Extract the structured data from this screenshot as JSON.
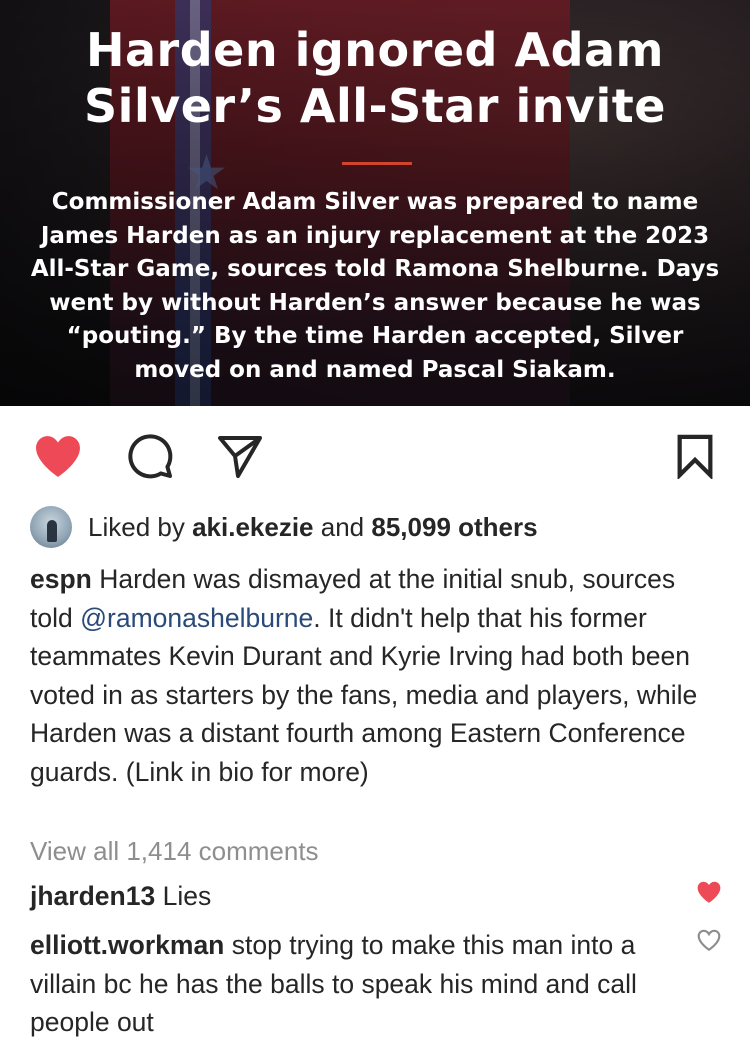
{
  "post_image": {
    "headline": "Harden ignored Adam Silver’s All-Star invite",
    "dek": "Commissioner Adam Silver was prepared to name James Harden as an injury replacement at the 2023 All-Star Game, sources told Ramona Shelburne. Days went by without Harden’s answer because he was “pouting.” By the time Harden accepted, Silver moved on and named Pascal Siakam.",
    "accent_color": "#d0452c"
  },
  "actions": {
    "like_icon": "heart-filled-icon",
    "comment_icon": "comment-icon",
    "share_icon": "send-icon",
    "save_icon": "bookmark-icon",
    "like_color": "#ed4956"
  },
  "likes": {
    "prefix": "Liked by",
    "user": "aki.ekezie",
    "middle": "and",
    "count": "85,099 others"
  },
  "caption": {
    "username": "espn",
    "text_before": "Harden was dismayed at the initial snub, sources told",
    "mention": "@ramonashelburne",
    "text_after": ". It didn't help that his former teammates Kevin Durant and Kyrie Irving had both been voted in as starters by the fans, media and players, while Harden was a distant fourth among Eastern Conference guards. (Link in bio for more)"
  },
  "view_all": "View all 1,414 comments",
  "comments": [
    {
      "username": "jharden13",
      "text": "Lies",
      "liked": true
    },
    {
      "username": "elliott.workman",
      "text": "stop trying to make this man into a villain bc he has the balls to speak his mind and call people out",
      "liked": false
    }
  ]
}
